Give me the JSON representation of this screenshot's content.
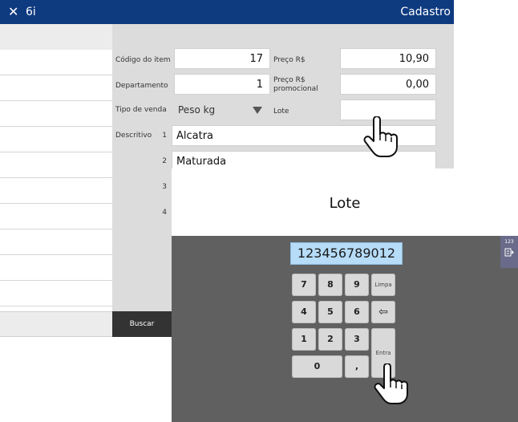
{
  "titlebar": {
    "close_glyph": "✕",
    "app_title": "6i",
    "screen_title": "Cadastro",
    "bg_color": "#0e3a80"
  },
  "form": {
    "codigo_label": "Código do item",
    "codigo_value": "17",
    "preco_label": "Preço R$",
    "preco_value": "10,90",
    "departamento_label": "Departamento",
    "departamento_value": "1",
    "preco_promo_label_1": "Preço R$",
    "preco_promo_label_2": "promocional",
    "preco_promo_value": "0,00",
    "tipo_venda_label": "Tipo de venda",
    "tipo_venda_value": "Peso kg",
    "lote_label": "Lote",
    "lote_value": "",
    "descritivo_label": "Descritivo",
    "descritivo_lines": [
      {
        "num": "1",
        "text": "Alcatra"
      },
      {
        "num": "2",
        "text": "Maturada"
      },
      {
        "num": "3",
        "text": ""
      },
      {
        "num": "4",
        "text": ""
      }
    ]
  },
  "buscar_label": "Buscar",
  "lote_dialog": {
    "title": "Lote",
    "input_value": "123456789012",
    "keys": {
      "k7": "7",
      "k8": "8",
      "k9": "9",
      "limpa": "Limpa",
      "k4": "4",
      "k5": "5",
      "k6": "6",
      "backspace": "⇦",
      "k1": "1",
      "k2": "2",
      "k3": "3",
      "entra": "Entra",
      "k0": "0",
      "comma": ","
    }
  },
  "side_tab": {
    "label": "123"
  },
  "icons": [
    "close-icon",
    "dropdown-arrow-icon",
    "hand-cursor-icon",
    "backspace-icon",
    "keyboard-icon"
  ]
}
